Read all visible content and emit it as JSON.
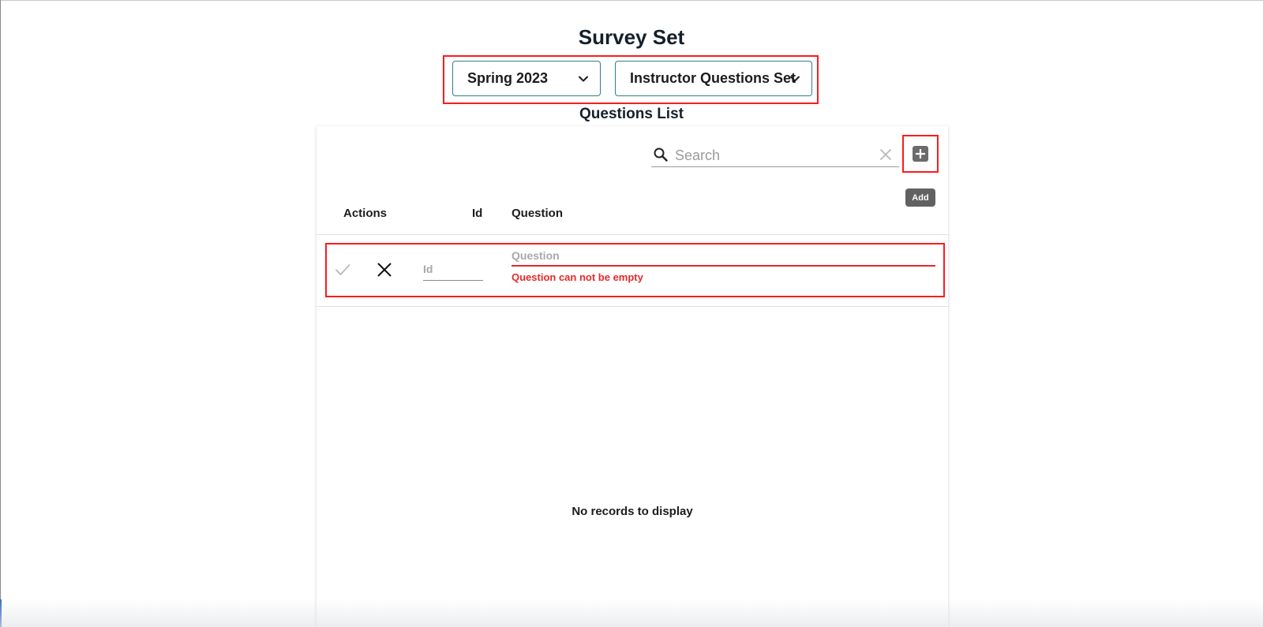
{
  "page": {
    "title": "Survey Set",
    "section_title": "Questions List"
  },
  "selectors": {
    "term": {
      "value": "Spring 2023",
      "icon": "chevron-down-icon"
    },
    "question_set": {
      "value": "Instructor Questions Set",
      "icon": "chevron-down-icon"
    }
  },
  "toolbar": {
    "search_placeholder": "Search",
    "search_icon": "search-icon",
    "clear_icon": "close-icon",
    "add_icon": "plus-square-icon",
    "add_tooltip": "Add"
  },
  "table": {
    "columns": [
      "Actions",
      "Id",
      "Question"
    ],
    "edit_row": {
      "save_icon": "check-icon",
      "cancel_icon": "close-icon",
      "id_placeholder": "Id",
      "question_placeholder": "Question",
      "question_error": "Question can not be empty"
    },
    "empty_message": "No records to display"
  },
  "colors": {
    "accent_border": "#2f7f86",
    "highlight": "#ff1a1a",
    "error": "#e52a2a"
  }
}
